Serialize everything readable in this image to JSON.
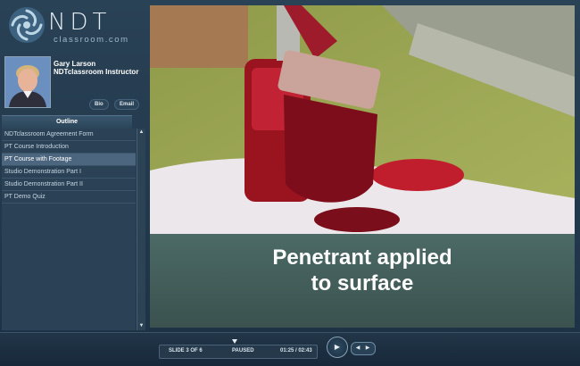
{
  "brand": {
    "logo_main": "NDT",
    "logo_sub": "classroom.com"
  },
  "instructor": {
    "name": "Gary Larson",
    "title": "NDTclassroom Instructor",
    "bio_label": "Bio",
    "email_label": "Email"
  },
  "outline": {
    "tab_label": "Outline",
    "items": [
      {
        "label": "NDTclassroom Agreement Form"
      },
      {
        "label": "PT Course Introduction"
      },
      {
        "label": "PT Course with Footage"
      },
      {
        "label": "Studio Demonstration Part I"
      },
      {
        "label": "Studio Demonstration Part II"
      },
      {
        "label": "PT Demo Quiz"
      }
    ],
    "selected_index": 2
  },
  "video": {
    "caption_line1": "Penetrant applied",
    "caption_line2": "to surface"
  },
  "player": {
    "slide_label": "SLIDE 3 OF 6",
    "status": "PAUSED",
    "time": "01:25 / 02:43",
    "progress": 0.52,
    "play_icon": "play-icon",
    "prev_icon": "skip-back-icon",
    "next_icon": "skip-forward-icon"
  },
  "colors": {
    "accent": "#4d6680",
    "caption_bg": "#4c6a66"
  }
}
